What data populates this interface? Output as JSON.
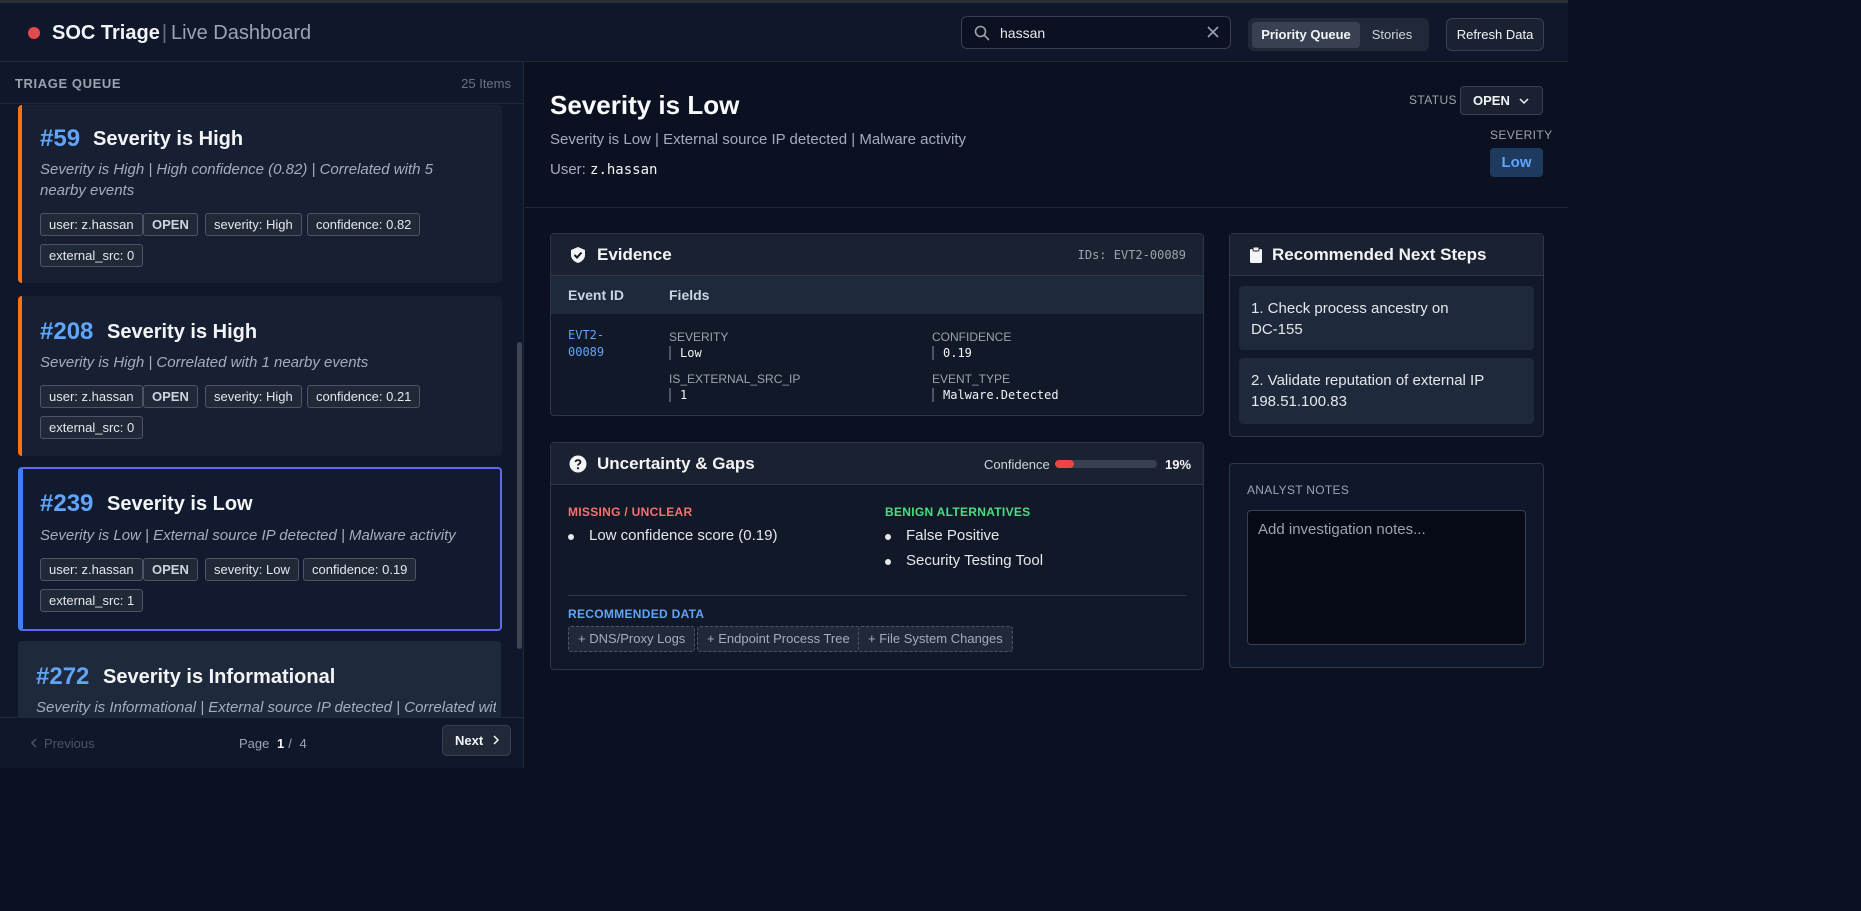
{
  "header": {
    "title": "SOC Triage",
    "separator": "|",
    "subtitle": "Live Dashboard",
    "search_value": "hassan",
    "views": [
      "Priority Queue",
      "Stories"
    ],
    "active_view": "Priority Queue",
    "refresh_label": "Refresh Data",
    "colors": {
      "live_dot": "#e5484d",
      "accent": "#3b82f6"
    }
  },
  "queue": {
    "title": "TRIAGE QUEUE",
    "count": "25 Items",
    "cards": [
      {
        "num": "#59",
        "title": "Severity is High",
        "desc": "Severity is High | High confidence (0.82) | Correlated with 5 nearby events",
        "tags": [
          "user: z.hassan",
          "OPEN",
          "severity: High",
          "confidence: 0.82",
          "external_src: 0"
        ],
        "accent": "#f97316"
      },
      {
        "num": "#208",
        "title": "Severity is High",
        "desc": "Severity is High | Correlated with 1 nearby events",
        "tags": [
          "user: z.hassan",
          "OPEN",
          "severity: High",
          "confidence: 0.21",
          "external_src: 0"
        ],
        "accent": "#f97316"
      },
      {
        "num": "#239",
        "title": "Severity is Low",
        "desc": "Severity is Low | External source IP detected | Malware activity",
        "tags": [
          "user: z.hassan",
          "OPEN",
          "severity: Low",
          "confidence: 0.19",
          "external_src: 1"
        ],
        "accent": "#3b82f6",
        "selected": true
      },
      {
        "num": "#272",
        "title": "Severity is Informational",
        "desc": "Severity is Informational | External source IP detected | Correlated with",
        "tags": []
      }
    ],
    "pager": {
      "prev": "Previous",
      "page_label": "Page",
      "current": "1",
      "sep": "/",
      "total": "4",
      "next": "Next"
    }
  },
  "detail": {
    "title": "Severity is Low",
    "summary": "Severity is Low | External source IP detected | Malware activity",
    "user_label": "User:",
    "user": "z.hassan",
    "status_label": "STATUS",
    "status": "OPEN",
    "severity_label": "SEVERITY",
    "severity": "Low",
    "evidence": {
      "title": "Evidence",
      "ids": "IDs: EVT2-00089",
      "col_event_id": "Event ID",
      "col_fields": "Fields",
      "event_id": "EVT2-00089",
      "fields": [
        {
          "label": "SEVERITY",
          "value": "Low"
        },
        {
          "label": "CONFIDENCE",
          "value": "0.19"
        },
        {
          "label": "IS_EXTERNAL_SRC_IP",
          "value": "1"
        },
        {
          "label": "EVENT_TYPE",
          "value": "Malware.Detected"
        }
      ]
    },
    "uncertainty": {
      "title": "Uncertainty & Gaps",
      "confidence_label": "Confidence",
      "confidence_value": 0.19,
      "confidence_pct": "19%",
      "missing_title": "MISSING / UNCLEAR",
      "missing": [
        "Low confidence score (0.19)"
      ],
      "benign_title": "BENIGN ALTERNATIVES",
      "benign": [
        "False Positive",
        "Security Testing Tool"
      ],
      "recommended_title": "RECOMMENDED DATA",
      "recommended": [
        "+ DNS/Proxy Logs",
        "+ Endpoint Process Tree",
        "+ File System Changes"
      ],
      "colors": {
        "missing": "#f87171",
        "benign": "#4ade80",
        "recommended": "#60a5fa",
        "bar": "#ef4444"
      }
    },
    "next_steps": {
      "title": "Recommended Next Steps",
      "steps": [
        "1. Check process ancestry on DC-155",
        "2. Validate reputation of external IP 198.51.100.83"
      ]
    },
    "notes": {
      "label": "ANALYST NOTES",
      "placeholder": "Add investigation notes..."
    }
  }
}
